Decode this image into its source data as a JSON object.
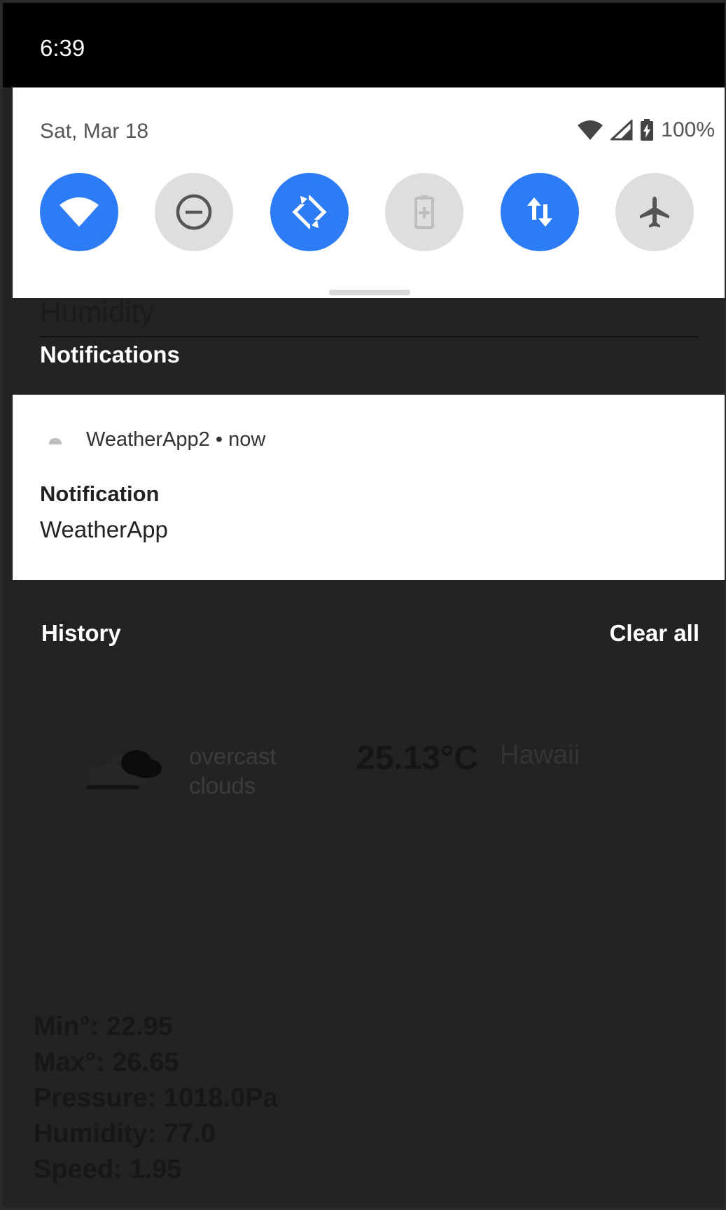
{
  "status_bar": {
    "time": "6:39"
  },
  "quick_settings": {
    "date": "Sat, Mar 18",
    "battery_percent": "100%",
    "tiles": [
      {
        "name": "wifi",
        "state": "on"
      },
      {
        "name": "do-not-disturb",
        "state": "off"
      },
      {
        "name": "auto-rotate",
        "state": "on"
      },
      {
        "name": "battery-saver",
        "state": "off"
      },
      {
        "name": "mobile-data",
        "state": "on"
      },
      {
        "name": "airplane-mode",
        "state": "off"
      }
    ]
  },
  "background_app": {
    "partial_label": "Humidity",
    "description_line1": "overcast",
    "description_line2": "clouds",
    "temperature": "25.13°C",
    "city": "Hawaii",
    "stats": {
      "min": "Min°: 22.95",
      "max": "Max°: 26.65",
      "pressure": "Pressure: 1018.0Pa",
      "humidity": "Humidity: 77.0",
      "speed": "Speed: 1.95"
    }
  },
  "notifications": {
    "header": "Notifications",
    "items": [
      {
        "app_name": "WeatherApp2 • now",
        "title": "Notification",
        "body": "WeatherApp"
      }
    ],
    "history_label": "History",
    "clear_all_label": "Clear all"
  },
  "colors": {
    "accent": "#2d7cf6",
    "tile_off": "#dedede",
    "scrim": "#232323"
  }
}
